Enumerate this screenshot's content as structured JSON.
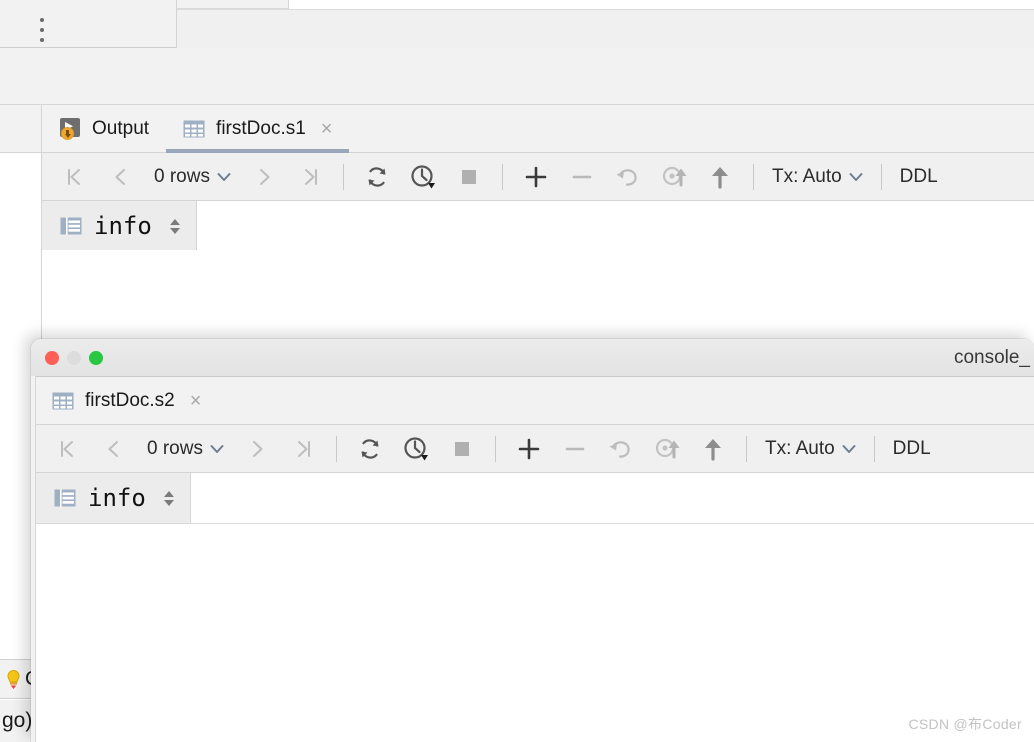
{
  "background_ide": {
    "kebab_menu_label": "More options",
    "left_rail_label": ""
  },
  "window1": {
    "tabs": [
      {
        "label": "Output",
        "icon": "output-run-icon",
        "active": false,
        "closable": false
      },
      {
        "label": "firstDoc.s1",
        "icon": "table-grid-icon",
        "active": true,
        "closable": true,
        "close_glyph": "×"
      }
    ],
    "toolbar": {
      "first_page_label": "|<",
      "prev_page_label": "<",
      "rows_label": "0 rows",
      "rows_dropdown_glyph": "⌄",
      "next_page_label": ">",
      "last_page_label": ">|",
      "reload_label": "Reload page",
      "query_time_label": "Query execution time",
      "stop_label": "Stop",
      "add_row_label": "+",
      "remove_row_label": "−",
      "revert_label": "Revert changes",
      "submit_label": "Submit and commit",
      "upload_label": "Upload",
      "tx_label": "Tx: Auto",
      "tx_dropdown_glyph": "⌄",
      "ddl_label": "DDL"
    },
    "subtabs": [
      {
        "label": "info",
        "icon": "table-grid-icon",
        "active": true
      }
    ]
  },
  "window2": {
    "title": "console_",
    "traffic_lights": {
      "close_color": "#ff5f56",
      "minimize_color": "#dddddd",
      "zoom_color": "#28c840"
    },
    "tabs": [
      {
        "label": "firstDoc.s2",
        "icon": "table-grid-icon",
        "active": false,
        "closable": true,
        "close_glyph": "×"
      }
    ],
    "toolbar": {
      "first_page_label": "|<",
      "prev_page_label": "<",
      "rows_label": "0 rows",
      "rows_dropdown_glyph": "⌄",
      "next_page_label": ">",
      "last_page_label": ">|",
      "reload_label": "Reload page",
      "query_time_label": "Query execution time",
      "stop_label": "Stop",
      "add_row_label": "+",
      "remove_row_label": "−",
      "revert_label": "Revert changes",
      "submit_label": "Submit and commit",
      "upload_label": "Upload",
      "tx_label": "Tx: Auto",
      "tx_dropdown_glyph": "⌄",
      "ddl_label": "DDL"
    },
    "subtabs": [
      {
        "label": "info",
        "icon": "table-grid-icon",
        "active": true
      }
    ]
  },
  "fragments": {
    "bulb_text": "C",
    "go_text": "go)"
  },
  "watermark": "CSDN @布Coder",
  "colors": {
    "active_tab_underline": "#9aa7bb",
    "grid_icon": "#9fb0c4",
    "toolbar_bg": "#f0f0f0",
    "tabstrip_bg": "#f2f2f2",
    "output_badge": "#f0a732"
  }
}
